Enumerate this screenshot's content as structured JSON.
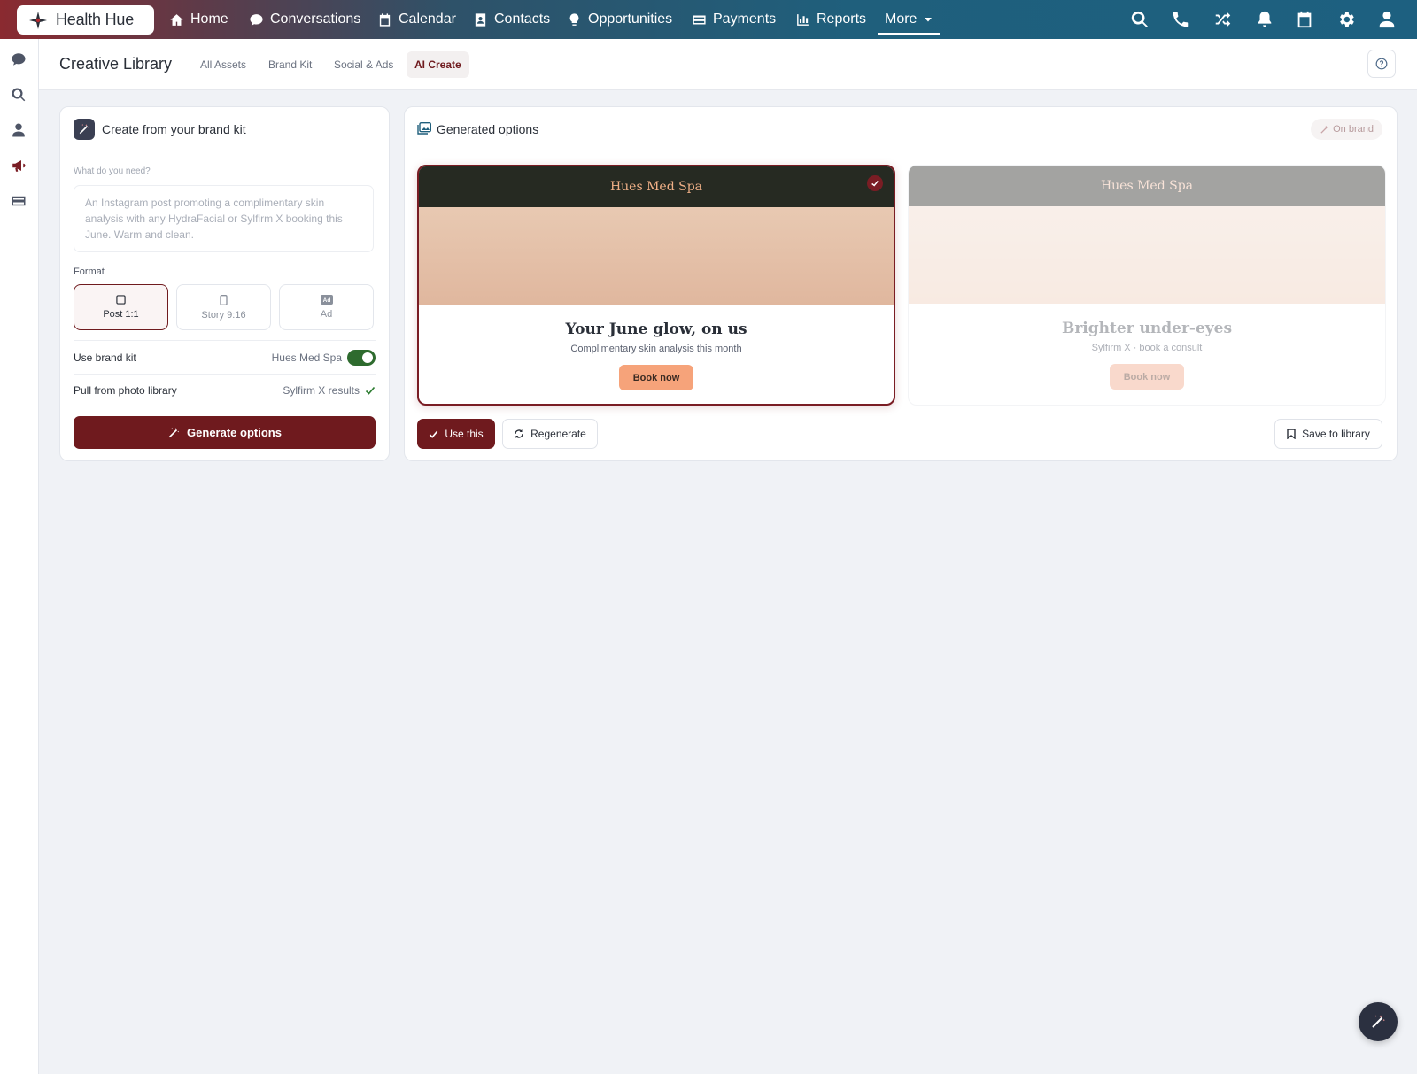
{
  "brand": {
    "logo_text": "Health Hue"
  },
  "nav": {
    "items": [
      {
        "label": "Home",
        "icon": "home-icon"
      },
      {
        "label": "Conversations",
        "icon": "chat-icon"
      },
      {
        "label": "Calendar",
        "icon": "calendar-icon"
      },
      {
        "label": "Contacts",
        "icon": "contact-card-icon"
      },
      {
        "label": "Opportunities",
        "icon": "lightbulb-icon"
      },
      {
        "label": "Payments",
        "icon": "credit-card-icon"
      },
      {
        "label": "Reports",
        "icon": "bar-chart-icon"
      }
    ],
    "more_label": "More",
    "right_icons": [
      "search-icon",
      "phone-icon",
      "shuffle-icon",
      "bell-icon",
      "calendar-icon",
      "gear-icon",
      "user-icon"
    ]
  },
  "sidebar": {
    "icons": [
      "chat-icon",
      "search-icon",
      "user-icon",
      "megaphone-icon",
      "credit-card-icon"
    ]
  },
  "subheader": {
    "title": "Creative Library",
    "tabs": [
      {
        "label": "All Assets",
        "active": false
      },
      {
        "label": "Brand Kit",
        "active": false
      },
      {
        "label": "Social & Ads",
        "active": false
      },
      {
        "label": "AI Create",
        "active": true
      }
    ]
  },
  "create_panel": {
    "title": "Create from your brand kit",
    "prompt_label": "What do you need?",
    "prompt_placeholder": "An Instagram post promoting a complimentary skin analysis with any HydraFacial or Sylfirm X booking this June. Warm and clean.",
    "format_label": "Format",
    "formats": [
      {
        "label": "Post 1:1",
        "selected": true
      },
      {
        "label": "Story 9:16",
        "selected": false
      },
      {
        "label": "Ad",
        "selected": false
      }
    ],
    "brand_kit_label": "Use brand kit",
    "brand_kit_value": "Hues Med Spa",
    "brand_kit_enabled": true,
    "photo_label": "Pull from photo library",
    "photo_value": "Sylfirm X results",
    "generate_label": "Generate options"
  },
  "options_panel": {
    "title": "Generated options",
    "badge": "On brand",
    "options": [
      {
        "brand": "Hues Med Spa",
        "headline": "Your June glow, on us",
        "subtext": "Complimentary skin analysis this month",
        "cta": "Book now",
        "selected": true
      },
      {
        "brand": "Hues Med Spa",
        "headline": "Brighter under-eyes",
        "subtext": "Sylfirm X · book a consult",
        "cta": "Book now",
        "selected": false
      }
    ],
    "use_label": "Use this",
    "regenerate_label": "Regenerate",
    "save_label": "Save to library"
  },
  "colors": {
    "brand_maroon": "#6f1a1e",
    "toggle_green": "#2e6b2e",
    "cta_peach": "#f6a37a"
  }
}
